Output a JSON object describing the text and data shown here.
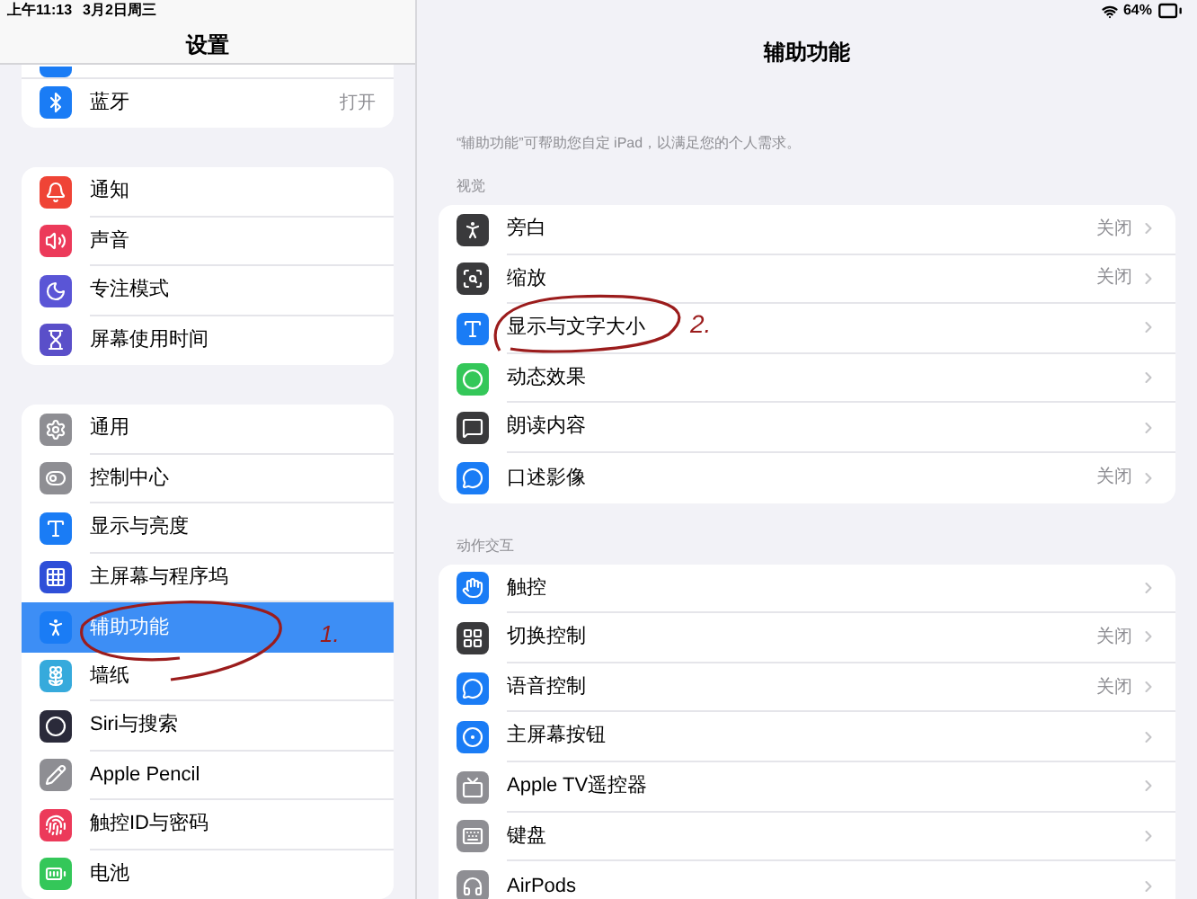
{
  "status_bar": {
    "time": "上午11:13",
    "date": "3月2日周三",
    "battery": "64%"
  },
  "sidebar": {
    "title": "设置",
    "groups": [
      {
        "items": [
          {
            "label": "蓝牙",
            "value": "打开",
            "selected": false,
            "color": "#1a7cf5"
          }
        ]
      },
      {
        "items": [
          {
            "label": "通知",
            "selected": false,
            "color": "#ef4436"
          },
          {
            "label": "声音",
            "selected": false,
            "color": "#ec3a5a"
          },
          {
            "label": "专注模式",
            "selected": false,
            "color": "#5a55d6"
          },
          {
            "label": "屏幕使用时间",
            "selected": false,
            "color": "#5a4fc9"
          }
        ]
      },
      {
        "items": [
          {
            "label": "通用",
            "selected": false,
            "color": "#8e8e93"
          },
          {
            "label": "控制中心",
            "selected": false,
            "color": "#8e8e93"
          },
          {
            "label": "显示与亮度",
            "selected": false,
            "color": "#1a7cf5"
          },
          {
            "label": "主屏幕与程序坞",
            "selected": false,
            "color": "#2f4fd8"
          },
          {
            "label": "辅助功能",
            "selected": true,
            "color": "#1a7cf5"
          },
          {
            "label": "墙纸",
            "selected": false,
            "color": "#36aadc"
          },
          {
            "label": "Siri与搜索",
            "selected": false,
            "color": "#2a2a3a"
          },
          {
            "label": "Apple Pencil",
            "selected": false,
            "color": "#8e8e93"
          },
          {
            "label": "触控ID与密码",
            "selected": false,
            "color": "#ec3a5a"
          },
          {
            "label": "电池",
            "selected": false,
            "color": "#34c759"
          }
        ]
      }
    ]
  },
  "detail": {
    "title": "辅助功能",
    "description": "“辅助功能”可帮助您自定 iPad，以满足您的个人需求。",
    "sections": [
      {
        "header": "视觉",
        "items": [
          {
            "label": "旁白",
            "value": "关闭",
            "color": "#3a3a3c"
          },
          {
            "label": "缩放",
            "value": "关闭",
            "color": "#3a3a3c"
          },
          {
            "label": "显示与文字大小",
            "color": "#1a7cf5"
          },
          {
            "label": "动态效果",
            "color": "#34c759"
          },
          {
            "label": "朗读内容",
            "color": "#3a3a3c"
          },
          {
            "label": "口述影像",
            "value": "关闭",
            "color": "#1a7cf5"
          }
        ]
      },
      {
        "header": "动作交互",
        "items": [
          {
            "label": "触控",
            "color": "#1a7cf5"
          },
          {
            "label": "切换控制",
            "value": "关闭",
            "color": "#3a3a3c"
          },
          {
            "label": "语音控制",
            "value": "关闭",
            "color": "#1a7cf5"
          },
          {
            "label": "主屏幕按钮",
            "color": "#1a7cf5"
          },
          {
            "label": "Apple TV遥控器",
            "color": "#8e8e93"
          },
          {
            "label": "键盘",
            "color": "#8e8e93"
          },
          {
            "label": "AirPods",
            "color": "#8e8e93"
          }
        ]
      }
    ]
  },
  "annotations": [
    {
      "label": "1."
    },
    {
      "label": "2."
    }
  ]
}
